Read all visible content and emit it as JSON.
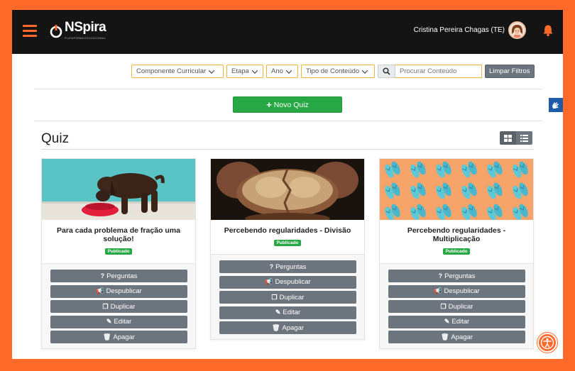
{
  "header": {
    "logo_text": "NSpira",
    "logo_sub": "PLATAFORMA EDUCACIONAL",
    "user_name": "Cristina Pereira Chagas (TE)",
    "menu_icon": "hamburger-icon",
    "notification_icon": "bell-icon"
  },
  "filters": {
    "componente": "Componente Curricular",
    "etapa": "Etapa",
    "ano": "Ano",
    "tipo": "Tipo de Conteúdo",
    "search_placeholder": "Procurar Conteúdo",
    "clear_label": "Limpar Filtros"
  },
  "new_quiz_label": "Novo Quiz",
  "section_title": "Quiz",
  "cards": [
    {
      "title": "Para cada problema de fração uma solução!",
      "status": "Publicado",
      "image": "puppy eating from red bowl",
      "actions": [
        "Perguntas",
        "Despublicar",
        "Duplicar",
        "Editar",
        "Apagar"
      ]
    },
    {
      "title": "Percebendo regularidades - Divisão",
      "status": "Publicado",
      "image": "hands breaking bread",
      "actions": [
        "Perguntas",
        "Despublicar",
        "Duplicar",
        "Editar",
        "Apagar"
      ]
    },
    {
      "title": "Percebendo regularidades - Multiplicação",
      "status": "Publicado",
      "image": "flip-flops pattern",
      "actions": [
        "Perguntas",
        "Despublicar",
        "Duplicar",
        "Editar",
        "Apagar"
      ]
    }
  ],
  "colors": {
    "frame": "#ff6a2b",
    "topbar": "#141414",
    "primary_green": "#28a745",
    "button_gray": "#6c757d",
    "filter_border": "#f0b43a"
  }
}
